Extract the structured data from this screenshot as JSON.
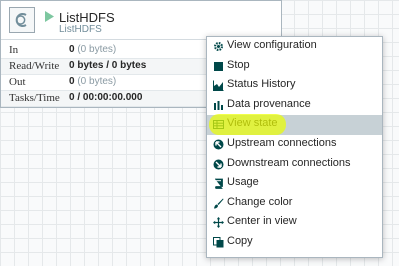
{
  "processor": {
    "name": "ListHDFS",
    "type": "ListHDFS",
    "stats": [
      {
        "label": "In",
        "value": "0",
        "extra": "(0 bytes)"
      },
      {
        "label": "Read/Write",
        "value": "0 bytes / 0 bytes",
        "extra": ""
      },
      {
        "label": "Out",
        "value": "0",
        "extra": "(0 bytes)"
      },
      {
        "label": "Tasks/Time",
        "value": "0 / 00:00:00.000",
        "extra": ""
      }
    ]
  },
  "context_menu": {
    "items": [
      {
        "label": "View configuration",
        "icon": "gear-icon"
      },
      {
        "label": "Stop",
        "icon": "stop-icon"
      },
      {
        "label": "Status History",
        "icon": "area-chart-icon"
      },
      {
        "label": "Data provenance",
        "icon": "provenance-icon"
      },
      {
        "label": "View state",
        "icon": "table-icon",
        "selected": true
      },
      {
        "label": "Upstream connections",
        "icon": "upstream-icon"
      },
      {
        "label": "Downstream connections",
        "icon": "downstream-icon"
      },
      {
        "label": "Usage",
        "icon": "book-icon"
      },
      {
        "label": "Change color",
        "icon": "paint-brush-icon"
      },
      {
        "label": "Center in view",
        "icon": "crosshair-icon"
      },
      {
        "label": "Copy",
        "icon": "copy-icon"
      }
    ]
  },
  "colors": {
    "accent_play": "#7dc7a0",
    "highlight": "#ebff00",
    "selected_bg": "#c7d1d6"
  }
}
